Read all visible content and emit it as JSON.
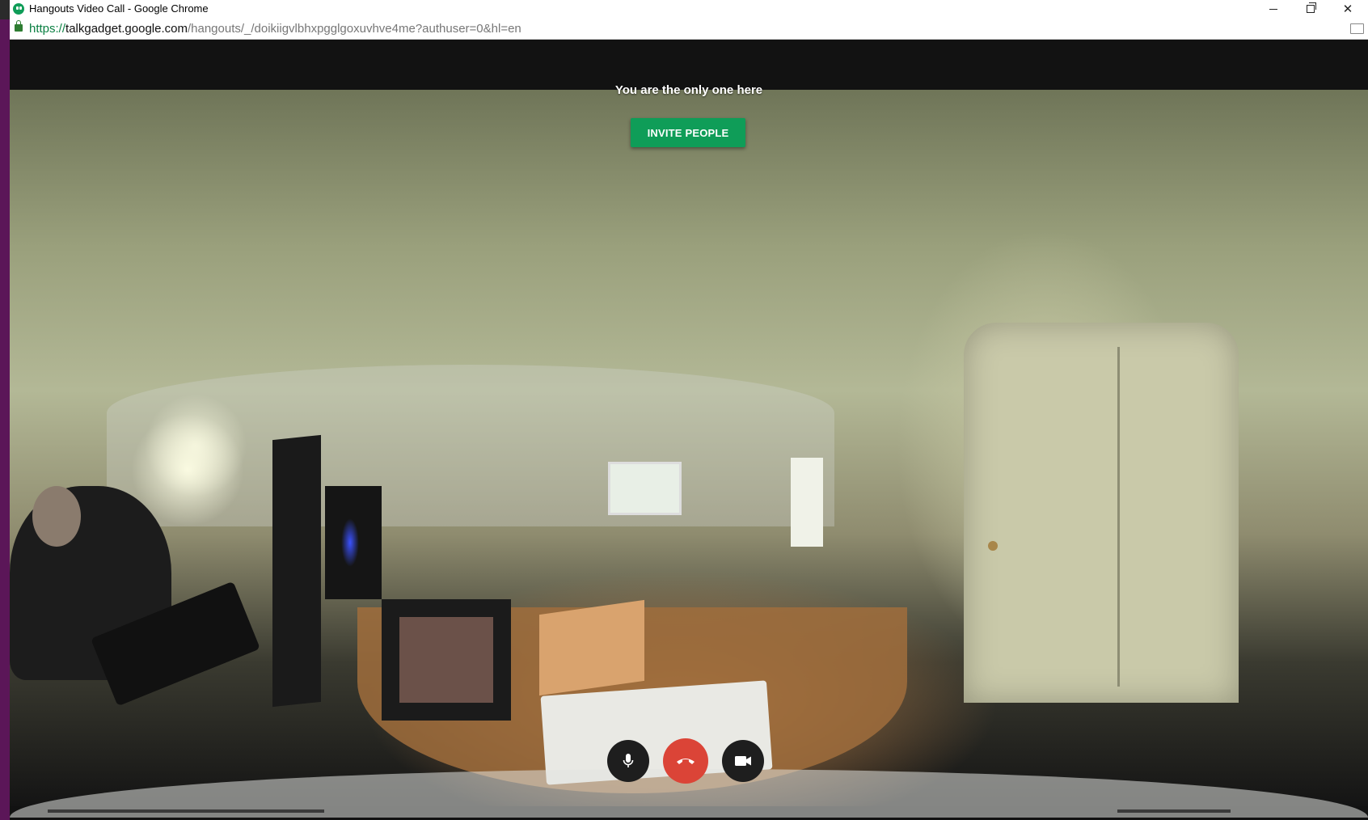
{
  "window": {
    "title": "Hangouts Video Call - Google Chrome",
    "app_icon": "hangouts-icon"
  },
  "address_bar": {
    "scheme": "https://",
    "host": "talkgadget.google.com",
    "path": "/hangouts/_/doikiigvlbhxpgglgoxuvhve4me?authuser=0&hl=en",
    "secure": true
  },
  "call": {
    "status_message": "You are the only one here",
    "invite_label": "INVITE PEOPLE",
    "controls": [
      {
        "name": "microphone",
        "icon": "mic-icon"
      },
      {
        "name": "hang-up",
        "icon": "phone-hangup-icon"
      },
      {
        "name": "camera",
        "icon": "video-camera-icon"
      }
    ]
  },
  "colors": {
    "invite_button": "#0f9d58",
    "hangup_button": "#db4437",
    "call_background": "#121212",
    "secure_scheme": "#0b8043"
  }
}
